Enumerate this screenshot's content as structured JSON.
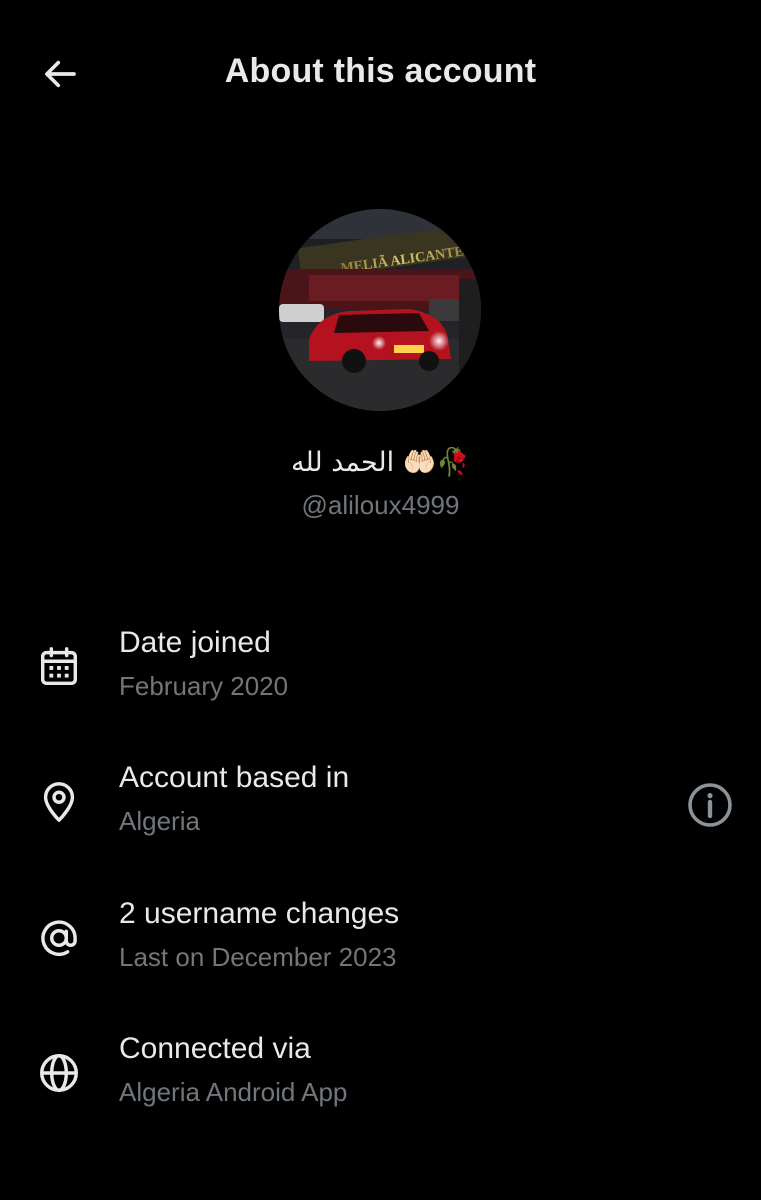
{
  "header": {
    "title": "About this account"
  },
  "profile": {
    "display_name": "الحمد لله 🤲🏻🥀",
    "handle": "@aliloux4999",
    "avatar_sign_text": "MELIÃ ALICANTE"
  },
  "details": [
    {
      "icon": "calendar-icon",
      "label": "Date joined",
      "value": "February 2020"
    },
    {
      "icon": "location-pin-icon",
      "label": "Account based in",
      "value": "Algeria"
    },
    {
      "icon": "at-sign-icon",
      "label": "2 username changes",
      "value": "Last on December 2023"
    },
    {
      "icon": "globe-icon",
      "label": "Connected via",
      "value": "Algeria Android App"
    }
  ],
  "colors": {
    "background": "#000000",
    "primary_text": "#e7e9ea",
    "secondary_text": "#71767b"
  }
}
